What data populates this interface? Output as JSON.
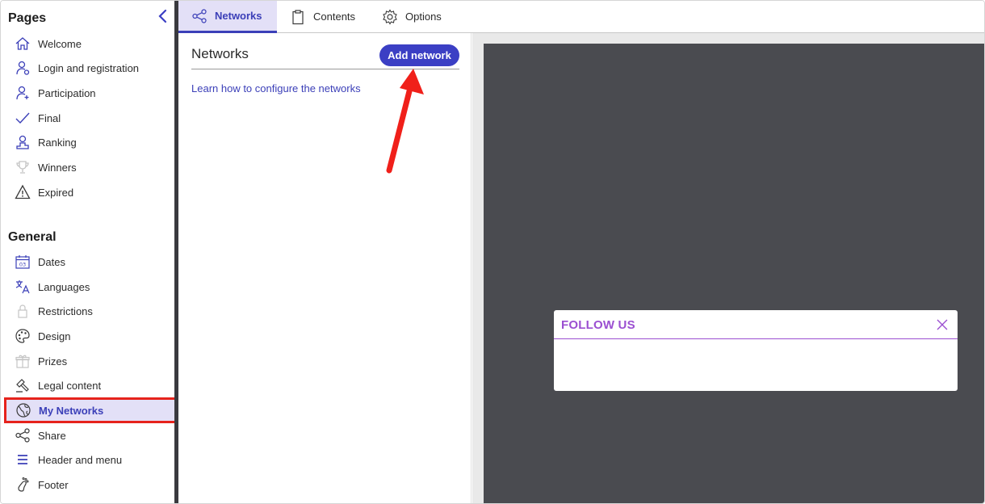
{
  "sidebar": {
    "pages_title": "Pages",
    "general_title": "General",
    "pages_items": [
      {
        "label": "Welcome",
        "icon": "home-icon"
      },
      {
        "label": "Login and registration",
        "icon": "user-key-icon"
      },
      {
        "label": "Participation",
        "icon": "user-plus-icon"
      },
      {
        "label": "Final",
        "icon": "check-icon"
      },
      {
        "label": "Ranking",
        "icon": "ranking-icon"
      },
      {
        "label": "Winners",
        "icon": "trophy-icon"
      },
      {
        "label": "Expired",
        "icon": "warning-icon"
      }
    ],
    "general_items": [
      {
        "label": "Dates",
        "icon": "calendar-icon"
      },
      {
        "label": "Languages",
        "icon": "translate-icon"
      },
      {
        "label": "Restrictions",
        "icon": "lock-icon"
      },
      {
        "label": "Design",
        "icon": "palette-icon"
      },
      {
        "label": "Prizes",
        "icon": "gift-icon"
      },
      {
        "label": "Legal content",
        "icon": "gavel-icon"
      },
      {
        "label": "My Networks",
        "icon": "globe-icon",
        "active": true
      },
      {
        "label": "Share",
        "icon": "share-icon"
      },
      {
        "label": "Header and menu",
        "icon": "menu-icon"
      },
      {
        "label": "Footer",
        "icon": "footprint-icon"
      }
    ]
  },
  "tabs": [
    {
      "label": "Networks",
      "icon": "share-icon",
      "active": true
    },
    {
      "label": "Contents",
      "icon": "clipboard-icon"
    },
    {
      "label": "Options",
      "icon": "gear-icon"
    }
  ],
  "panel": {
    "title": "Networks",
    "add_button": "Add network",
    "learn_link": "Learn how to configure the networks"
  },
  "preview": {
    "modal_title": "FOLLOW US"
  },
  "colors": {
    "accent": "#3b3fc4",
    "highlight": "#e6231c",
    "modal_accent": "#9b4fd1",
    "preview_bg": "#4a4b50"
  }
}
